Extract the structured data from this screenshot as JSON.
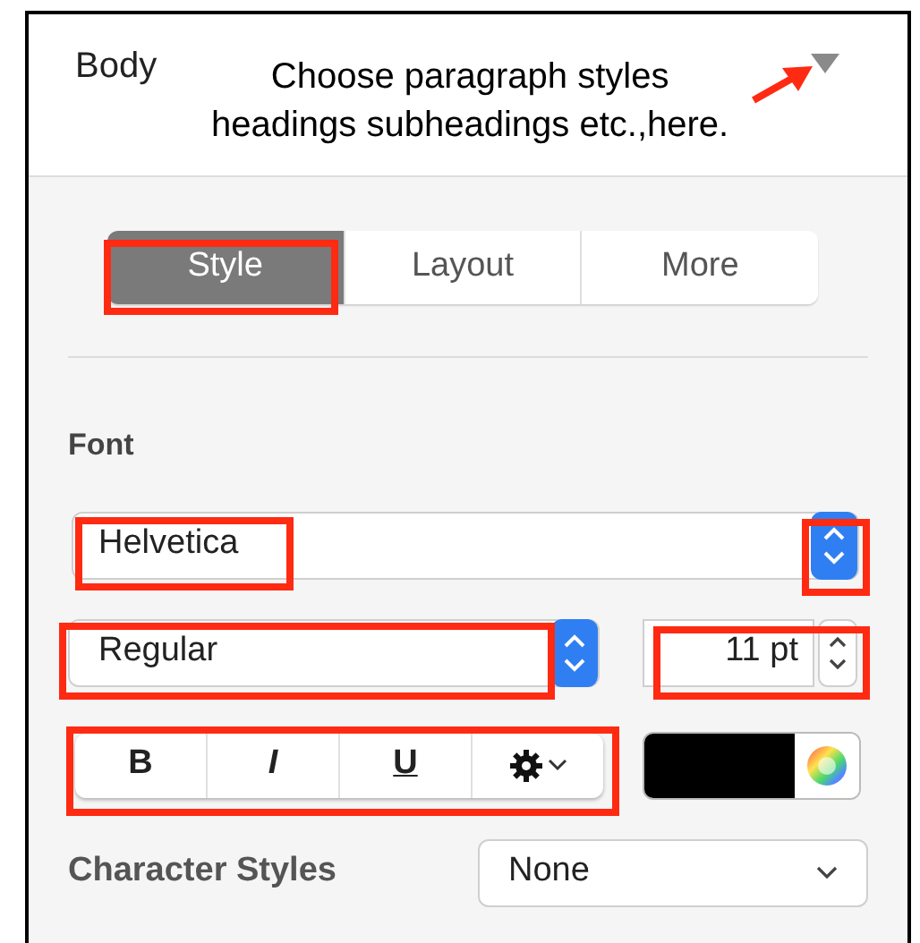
{
  "header": {
    "title": "Body"
  },
  "annotation": {
    "lines": [
      "Choose paragraph styles",
      "headings subheadings etc.,here."
    ]
  },
  "tabs": [
    {
      "label": "Style",
      "selected": true,
      "highlighted": true
    },
    {
      "label": "Layout",
      "selected": false,
      "highlighted": false
    },
    {
      "label": "More",
      "selected": false,
      "highlighted": false
    }
  ],
  "font": {
    "label": "Font",
    "family": {
      "value": "Helvetica",
      "highlighted": true,
      "stepper_highlighted": true
    },
    "typeface": {
      "value": "Regular",
      "highlighted": true
    },
    "size": {
      "value": "11 pt",
      "highlighted": true
    },
    "style_buttons": {
      "highlighted": true,
      "items": [
        {
          "kind": "bold",
          "label": "B"
        },
        {
          "kind": "italic",
          "label": "I"
        },
        {
          "kind": "underline",
          "label": "U"
        },
        {
          "kind": "gear"
        }
      ]
    }
  },
  "character_styles": {
    "label": "Character Styles",
    "value": "None"
  }
}
